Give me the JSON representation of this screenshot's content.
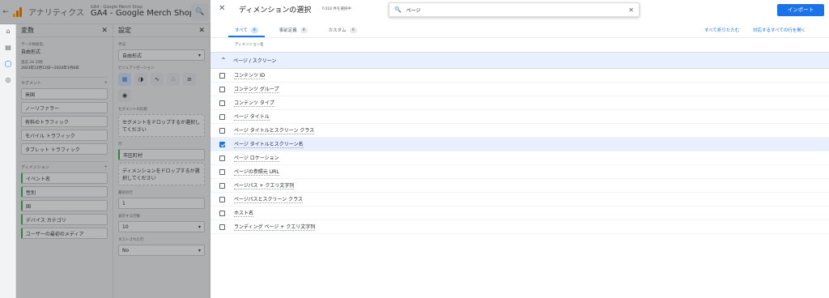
{
  "app": {
    "name": "アナリティクス",
    "property_sub": "GA4 - Google Merch Shop",
    "property_main": "GA4 - Google Merch Shop"
  },
  "variables_panel": {
    "title": "変数",
    "name_label": "データ探索名:",
    "name_value": "自由形式",
    "date_label": "過去 28 日間",
    "date_value": "2023年12月12日～2024年1月8日",
    "segments_label": "セグメント",
    "segments": [
      "米国",
      "ノーリファラー",
      "有料のトラフィック",
      "モバイル トラフィック",
      "タブレット トラフィック"
    ],
    "dimensions_label": "ディメンション",
    "dimensions": [
      "イベント名",
      "性別",
      "国",
      "デバイス カテゴリ",
      "ユーザーの最初のメディア"
    ]
  },
  "settings_panel": {
    "title": "設定",
    "technique_label": "手法",
    "technique_value": "自由形式",
    "viz_label": "ビジュアリゼーション",
    "segment_compare_label": "セグメントの比較",
    "segment_drop": "セグメントをドロップするか選択してください",
    "rows_label": "行",
    "row_item": "市区町村",
    "dim_drop": "ディメンションをドロップするか選択してください",
    "start_row_label": "最初の行",
    "start_row_value": "1",
    "show_rows_label": "表示する行数",
    "show_rows_value": "10",
    "nested_label": "ネストされた行",
    "nested_value": "No"
  },
  "dialog": {
    "title": "ディメンションの選択",
    "count": "7/318 件を選択中",
    "search_value": "ページ",
    "import_label": "インポート",
    "tabs": [
      {
        "label": "すべて",
        "count": "8"
      },
      {
        "label": "事前定義",
        "count": "8"
      },
      {
        "label": "カスタム",
        "count": "0"
      }
    ],
    "collapse_all": "すべて折りたたむ",
    "expand_all": "対応するすべての行を開く",
    "column_header": "ディメンション名",
    "group_label": "ページ / スクリーン",
    "items": [
      {
        "label": "コンテンツ ID",
        "checked": false
      },
      {
        "label": "コンテンツ グループ",
        "checked": false
      },
      {
        "label": "コンテンツ タイプ",
        "checked": false
      },
      {
        "label": "ページ タイトル",
        "checked": false
      },
      {
        "label": "ページ タイトルとスクリーン クラス",
        "checked": false
      },
      {
        "label": "ページ タイトルとスクリーン名",
        "checked": true
      },
      {
        "label": "ページ ロケーション",
        "checked": false
      },
      {
        "label": "ページの参照元 URL",
        "checked": false
      },
      {
        "label": "ページパス + クエリ文字列",
        "checked": false
      },
      {
        "label": "ページパスとスクリーン クラス",
        "checked": false
      },
      {
        "label": "ホスト名",
        "checked": false
      },
      {
        "label": "ランディング ページ + クエリ文字列",
        "checked": false
      }
    ]
  },
  "colors": {
    "accent": "#1a73e8",
    "selected_row": "#e8f0fe"
  }
}
